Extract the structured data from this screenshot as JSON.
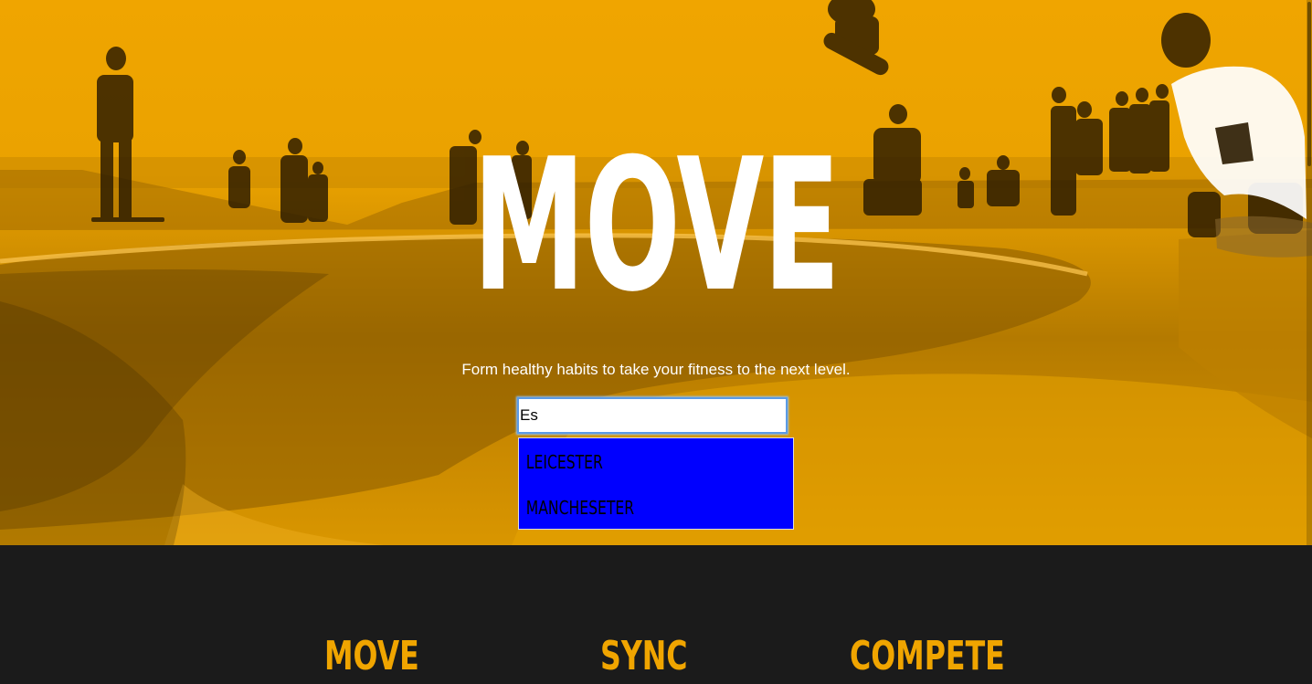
{
  "hero": {
    "title": "MOVE",
    "tagline": "Form healthy habits to take your fitness to the next level.",
    "background": "skatepark-photo-orange-duotone",
    "accent_color": "#f0a500"
  },
  "search": {
    "value": "Es",
    "suggestions": [
      "LEICESTER",
      "MANCHESETER"
    ],
    "dropdown_color": "#0000ff"
  },
  "features": {
    "items": [
      {
        "title": "MOVE"
      },
      {
        "title": "SYNC"
      },
      {
        "title": "COMPETE"
      }
    ],
    "heading_color": "#f0a500",
    "background_color": "#1b1b1b"
  }
}
